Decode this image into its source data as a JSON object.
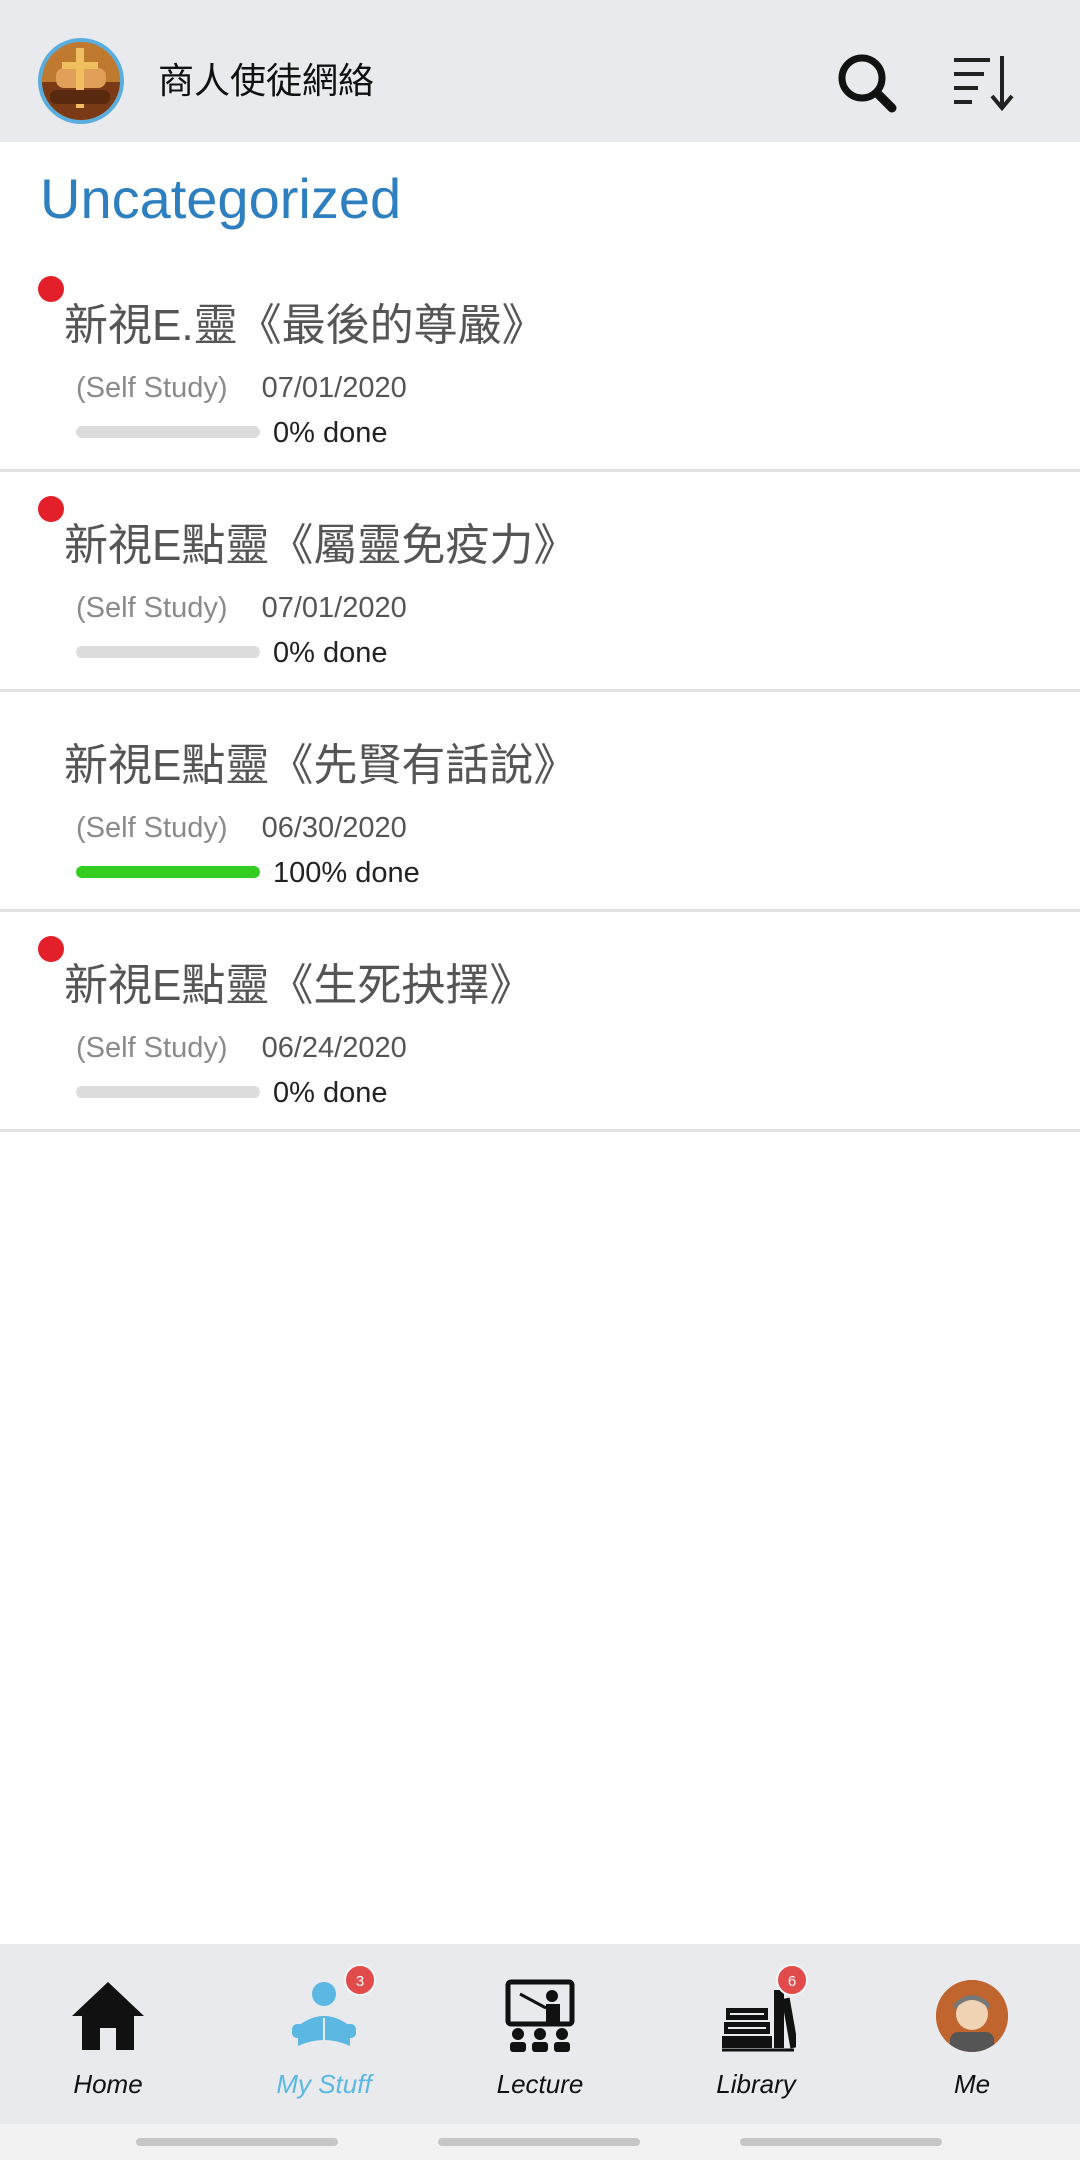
{
  "header": {
    "org_name": "商人使徒網絡",
    "avatar_icon": "org-logo-avatar",
    "search_icon": "search-icon",
    "sort_icon": "sort-icon"
  },
  "section": {
    "title": "Uncategorized"
  },
  "courses": [
    {
      "title": "新視E.靈《最後的尊嚴》",
      "type": "(Self Study)",
      "date": "07/01/2020",
      "progress_label": "0% done",
      "progress": 0,
      "unread": true
    },
    {
      "title": "新視E點靈《屬靈免疫力》",
      "type": "(Self Study)",
      "date": "07/01/2020",
      "progress_label": "0% done",
      "progress": 0,
      "unread": true
    },
    {
      "title": "新視E點靈《先賢有話說》",
      "type": "(Self Study)",
      "date": "06/30/2020",
      "progress_label": "100% done",
      "progress": 100,
      "unread": false
    },
    {
      "title": "新視E點靈《生死抉擇》",
      "type": "(Self Study)",
      "date": "06/24/2020",
      "progress_label": "0% done",
      "progress": 0,
      "unread": true
    }
  ],
  "nav": {
    "home": {
      "label": "Home",
      "icon": "home-icon"
    },
    "mystuff": {
      "label": "My Stuff",
      "icon": "reader-icon",
      "badge": "3"
    },
    "lecture": {
      "label": "Lecture",
      "icon": "lecture-icon"
    },
    "library": {
      "label": "Library",
      "icon": "books-icon",
      "badge": "6"
    },
    "me": {
      "label": "Me",
      "icon": "profile-avatar"
    }
  },
  "colors": {
    "accent": "#2e7fbf",
    "active_nav": "#5ab8e2",
    "unread_dot": "#e3202a",
    "progress_complete": "#32cd1e",
    "badge": "#e24b4b"
  }
}
